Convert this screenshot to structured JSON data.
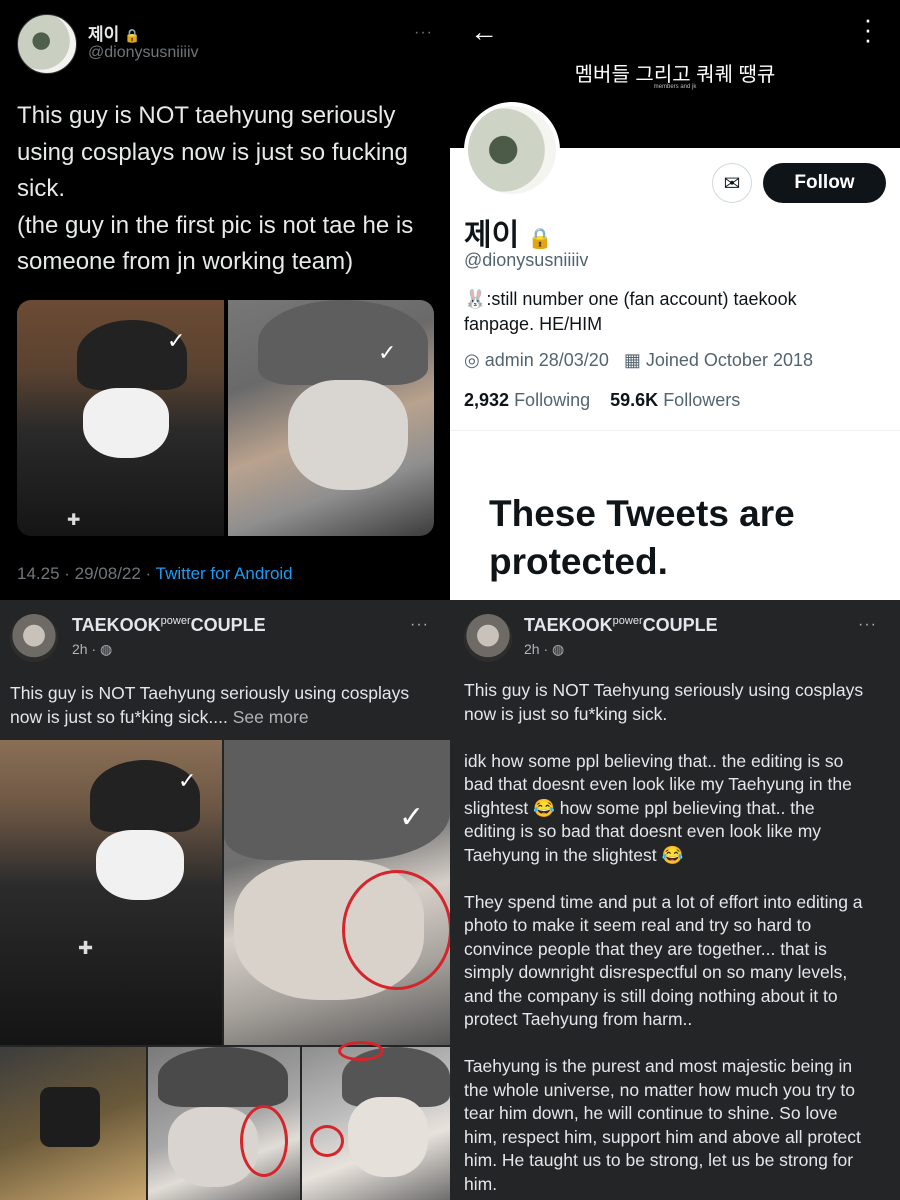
{
  "tweet": {
    "display_name": "제이",
    "handle": "@dionysusniiiiv",
    "more": "···",
    "text_lines": [
      "This guy is NOT taehyung seriously",
      "using cosplays now is just so fucking",
      "sick.",
      "(the guy in the first pic is not tae he is",
      "someone from jn working team)"
    ],
    "timestamp": "14.25 · 29/08/22 · ",
    "source": "Twitter for Android"
  },
  "profile": {
    "banner_title": "멤버들 그리고 쿼퀘 땡큐",
    "banner_subtitle": "members and jk",
    "follow_label": "Follow",
    "display_name": "제이",
    "handle": "@dionysusniiiiv",
    "bio_line1": "🐰:still number one (fan account) taekook",
    "bio_line2": "fanpage. HE/HIM",
    "location": "admin 28/03/20",
    "joined": "Joined October 2018",
    "following_count": "2,932",
    "following_label": "Following",
    "followers_count": "59.6K",
    "followers_label": "Followers",
    "protected_line1": "These Tweets are",
    "protected_line2": "protected."
  },
  "fb_post_short": {
    "page_name": "TAEKOOK",
    "page_name_sup": "power",
    "page_name_end": "COUPLE",
    "time": "2h · ",
    "more": "···",
    "text_line1": "This guy is NOT Taehyung seriously using cosplays",
    "text_line2": "now is just so fu*king sick.... ",
    "see_more": "See more"
  },
  "fb_post_full": {
    "page_name": "TAEKOOK",
    "page_name_sup": "power",
    "page_name_end": "COUPLE",
    "time": "2h · ",
    "more": "···",
    "paragraph1": [
      "This guy is NOT Taehyung seriously using cosplays",
      "now is just so fu*king sick."
    ],
    "paragraph2": [
      "idk how some ppl believing that.. the editing is so",
      "bad that doesnt even look like my Taehyung in the",
      "slightest 😂  how some ppl believing that.. the",
      "editing is so bad that doesnt even look like my",
      "Taehyung in the slightest 😂"
    ],
    "paragraph3": [
      "They spend time and put a lot of effort into editing a",
      "photo to make it seem real and try so hard to",
      "convince people that they are together... that is",
      "simply downright disrespectful on so many levels,",
      "and the company is still doing nothing about it to",
      "protect Taehyung from harm.."
    ],
    "paragraph4": [
      "Taehyung is the purest and most majestic being in",
      "the whole universe, no matter how much you try to",
      "tear him down, he will continue to shine. So love",
      "him, respect him, support him and above all protect",
      "him. He taught us to be strong, let us be strong for",
      "him."
    ]
  },
  "icons": {
    "lock": "🔒",
    "back": "←",
    "kebab": "⋮",
    "mail": "✉",
    "location": "◎",
    "calendar": "▦",
    "globe": "◍"
  },
  "colors": {
    "twitter_blue": "#1d9bf0",
    "fb_dark": "#242526",
    "annotation_red": "#d6242b"
  }
}
